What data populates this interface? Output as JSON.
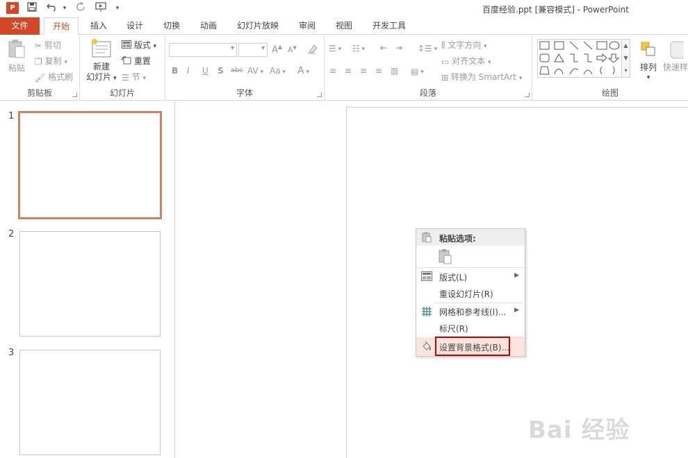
{
  "window": {
    "title": "百度经验.ppt [兼容模式] - PowerPoint",
    "app_icon_text": "P"
  },
  "tabs": [
    {
      "label": "文件"
    },
    {
      "label": "开始"
    },
    {
      "label": "插入"
    },
    {
      "label": "设计"
    },
    {
      "label": "切换"
    },
    {
      "label": "动画"
    },
    {
      "label": "幻灯片放映"
    },
    {
      "label": "审阅"
    },
    {
      "label": "视图"
    },
    {
      "label": "开发工具"
    }
  ],
  "ribbon": {
    "clipboard": {
      "label": "剪贴板",
      "paste": "粘贴",
      "cut": "剪切",
      "copy": "复制",
      "format_painter": "格式刷"
    },
    "slides": {
      "label": "幻灯片",
      "new_slide_line1": "新建",
      "new_slide_line2": "幻灯片",
      "layout": "版式",
      "reset": "重置",
      "section": "节"
    },
    "font": {
      "label": "字体",
      "bold": "B",
      "italic": "I",
      "underline": "U",
      "shadow": "S",
      "strike": "abc",
      "spacing": "AV",
      "case": "Aa",
      "color": "A",
      "grow": "A",
      "shrink": "A"
    },
    "paragraph": {
      "label": "段落",
      "text_direction": "文字方向",
      "align_text": "对齐文本",
      "smartart": "转换为 SmartArt"
    },
    "drawing": {
      "label": "绘图",
      "arrange": "排列",
      "quick_styles": "快速样"
    }
  },
  "slides": [
    {
      "number": "1"
    },
    {
      "number": "2"
    },
    {
      "number": "3"
    }
  ],
  "context_menu": {
    "header": "粘贴选项:",
    "items": [
      {
        "label": "版式(L)",
        "submenu": true
      },
      {
        "label": "重设幻灯片(R)",
        "submenu": false
      },
      {
        "label": "网格和参考线(I)...",
        "submenu": true
      },
      {
        "label": "标尺(R)",
        "submenu": false
      },
      {
        "label": "设置背景格式(B)...",
        "submenu": false
      }
    ]
  },
  "watermark": {
    "text": "Bai 经验"
  },
  "colors": {
    "accent": "#d24726",
    "selected_thumb": "#d0825f",
    "highlight_box": "#c00000"
  }
}
